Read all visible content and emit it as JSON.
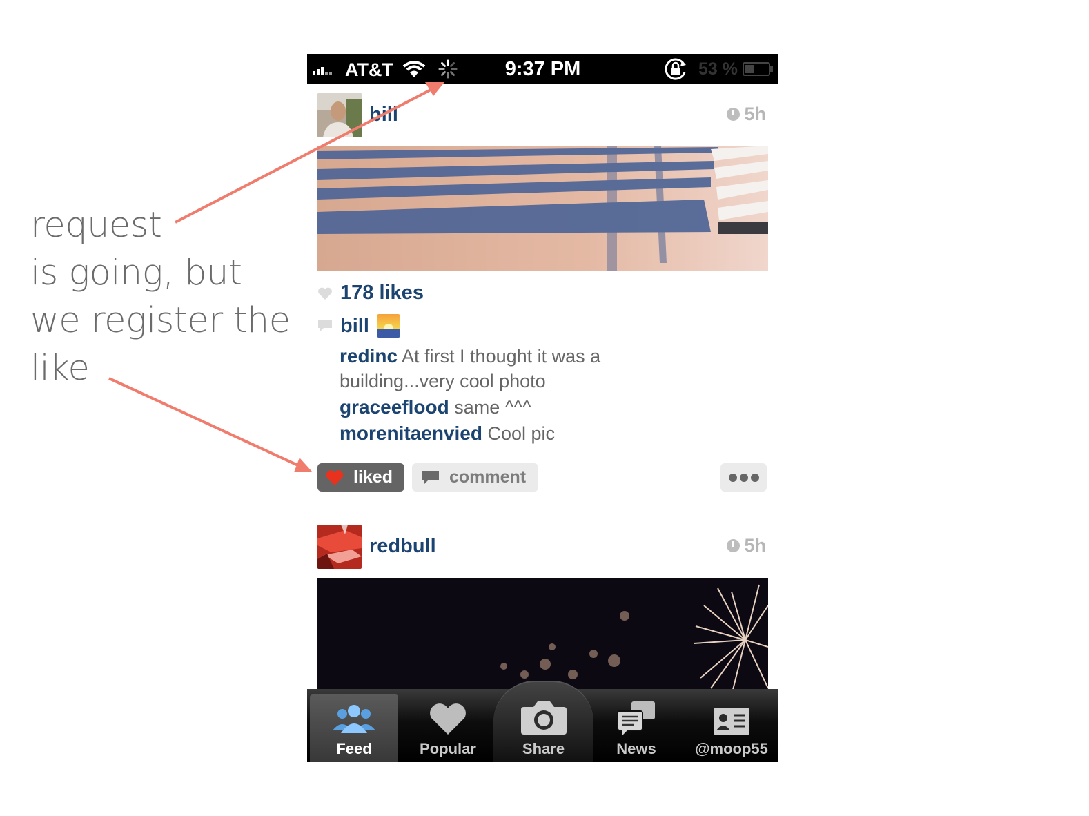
{
  "annotation": {
    "lines": [
      "request",
      "is going, but",
      "we register the",
      "like"
    ],
    "arrow_color": "#f07c6e"
  },
  "status_bar": {
    "carrier": "AT&T",
    "time": "9:37 PM",
    "battery": "53 %",
    "icons": [
      "signal-icon",
      "wifi-icon",
      "activity-spinner-icon",
      "rotation-lock-icon",
      "battery-icon"
    ]
  },
  "posts": [
    {
      "username": "bill",
      "time": "5h",
      "likes": "178 likes",
      "caption_user": "bill",
      "comments": [
        {
          "user": "redinc",
          "text": "At first I thought it was a building...very cool photo"
        },
        {
          "user": "graceeflood",
          "text": "same ^^^"
        },
        {
          "user": "morenitaenvied",
          "text": "Cool pic"
        }
      ],
      "actions": {
        "liked": "liked",
        "comment": "comment"
      }
    },
    {
      "username": "redbull",
      "time": "5h"
    }
  ],
  "tabs": [
    {
      "label": "Feed",
      "icon": "feed-people-icon",
      "active": true
    },
    {
      "label": "Popular",
      "icon": "heart-icon"
    },
    {
      "label": "Share",
      "icon": "camera-icon"
    },
    {
      "label": "News",
      "icon": "news-bubbles-icon"
    },
    {
      "label": "@moop55",
      "icon": "profile-card-icon"
    }
  ],
  "colors": {
    "username": "#1c4471",
    "liked_heart": "#e8321e",
    "liked_button": "#646464"
  }
}
